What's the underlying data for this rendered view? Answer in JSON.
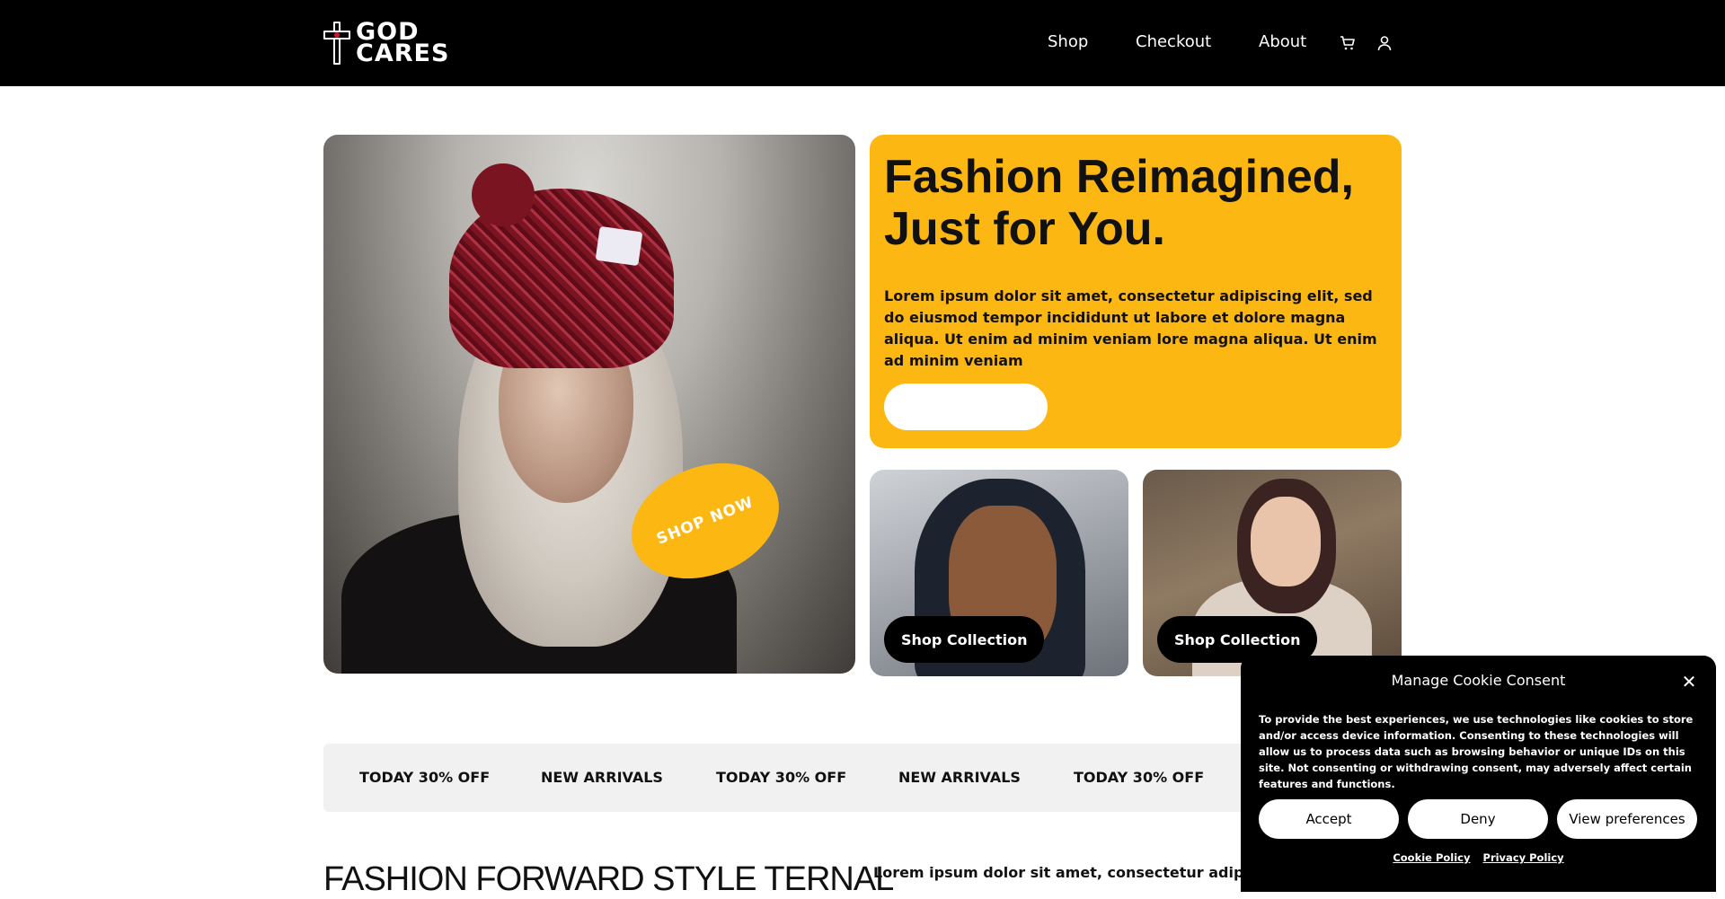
{
  "header": {
    "logo_line1": "GOD",
    "logo_line2": "CARES",
    "logo_cross_letters": "GOD CARES",
    "nav": {
      "shop": "Shop",
      "checkout": "Checkout",
      "about": "About"
    },
    "icons": [
      "cart-icon",
      "user-icon"
    ]
  },
  "hero": {
    "shop_now_badge": "SHOP NOW",
    "headline": "Fashion Reimagined, Just for You.",
    "body": "Lorem ipsum dolor sit amet, consectetur adipiscing elit, sed do eiusmod tempor incididunt ut labore et dolore magna aliqua. Ut enim ad minim veniam lore magna aliqua. Ut enim ad minim veniam",
    "cta_label": "",
    "tiles": [
      {
        "button": "Shop Collection"
      },
      {
        "button": "Shop Collection"
      }
    ]
  },
  "marquee": {
    "items": [
      "TODAY 30% OFF",
      "NEW ARRIVALS",
      "TODAY 30% OFF",
      "NEW ARRIVALS",
      "TODAY 30% OFF"
    ]
  },
  "section": {
    "title": "FASHION FORWARD STYLE TERNAL",
    "text": "Lorem ipsum dolor sit amet, consectetur adipiscing e"
  },
  "cookie": {
    "title": "Manage Cookie Consent",
    "body": "To provide the best experiences, we use technologies like cookies to store and/or access device information. Consenting to these technologies will allow us to process data such as browsing behavior or unique IDs on this site. Not consenting or withdrawing consent, may adversely affect certain features and functions.",
    "accept": "Accept",
    "deny": "Deny",
    "preferences": "View preferences",
    "cookie_policy": "Cookie Policy",
    "privacy_policy": "Privacy Policy",
    "close_icon": "close-icon"
  },
  "colors": {
    "header_bg": "#000000",
    "accent_yellow": "#fdb713",
    "marquee_bg": "#f1f1f1"
  }
}
